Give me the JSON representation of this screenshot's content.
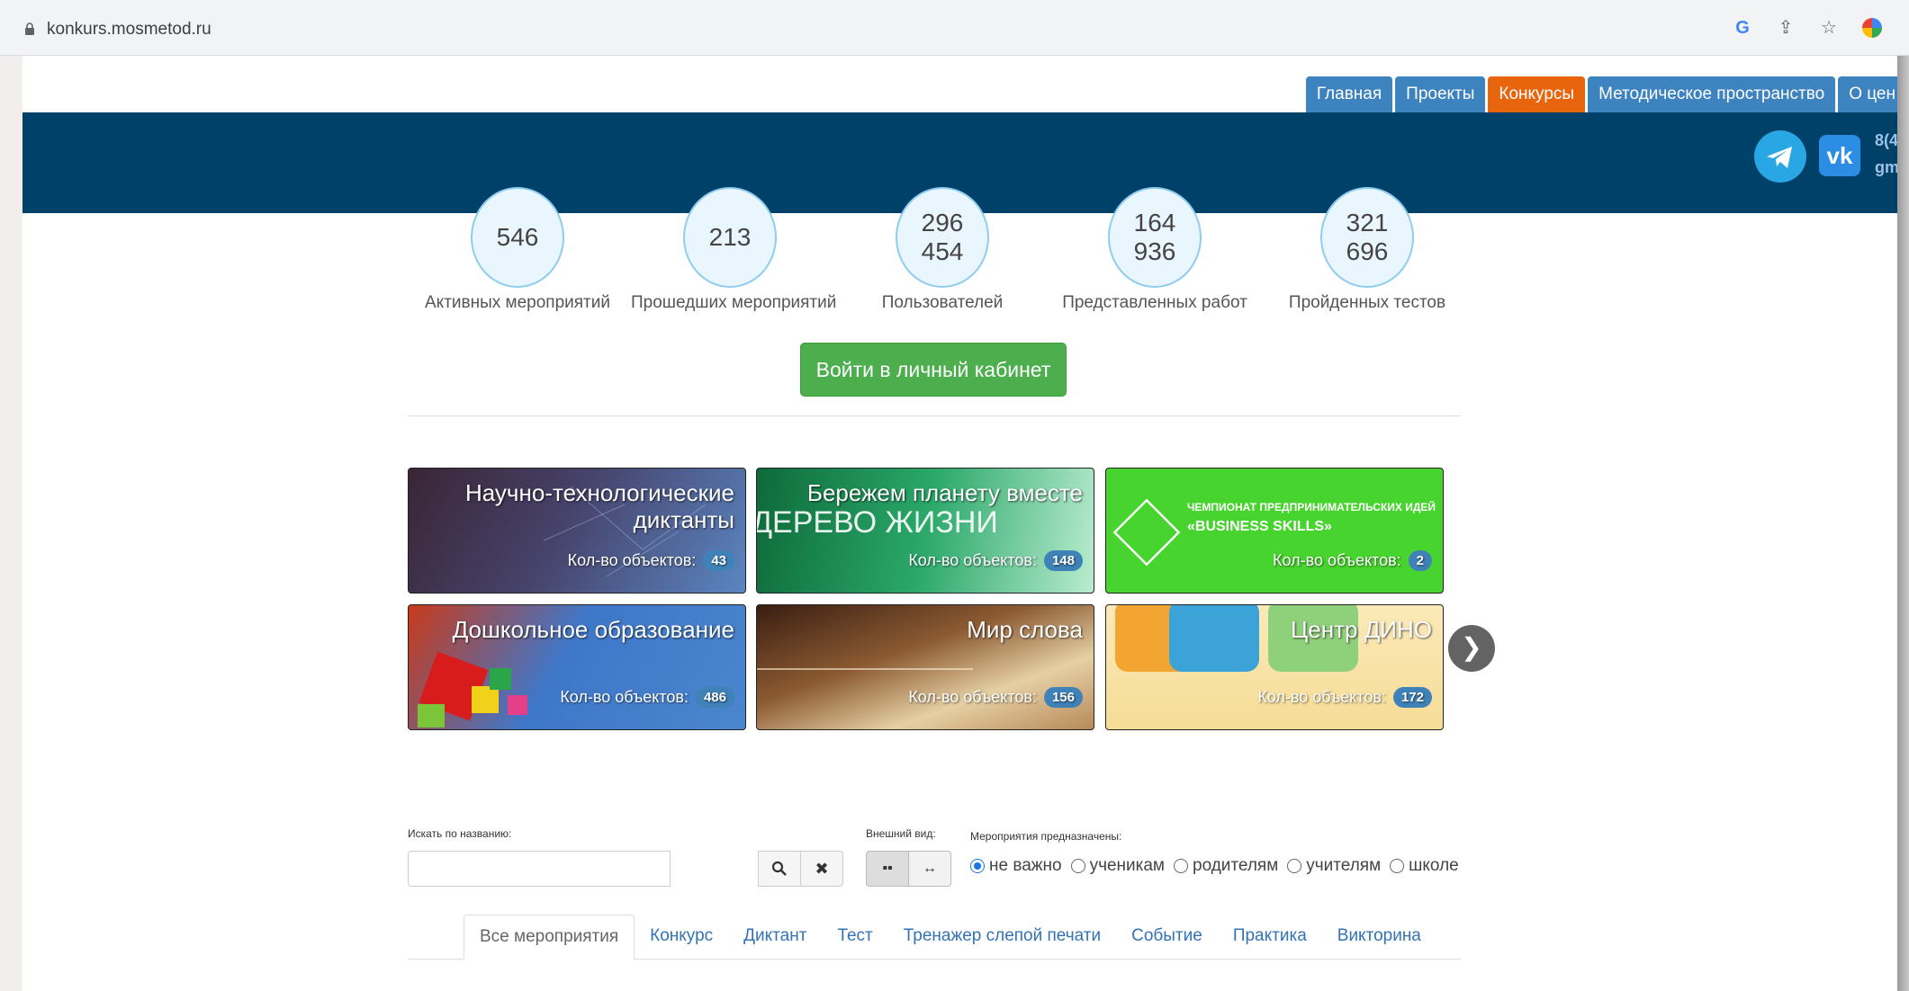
{
  "browser": {
    "url": "konkurs.mosmetod.ru"
  },
  "nav": {
    "tabs": [
      {
        "label": "Главная",
        "active": false
      },
      {
        "label": "Проекты",
        "active": false
      },
      {
        "label": "Конкурсы",
        "active": true
      },
      {
        "label": "Методическое пространство",
        "active": false
      },
      {
        "label": "О цен",
        "active": false
      }
    ]
  },
  "header": {
    "contact_line1": "8(4",
    "contact_line2": "gm"
  },
  "stats": [
    {
      "value": "546",
      "label": "Активных мероприятий"
    },
    {
      "value": "213",
      "label": "Прошедших мероприятий"
    },
    {
      "value": "296 454",
      "label": "Пользователей"
    },
    {
      "value": "164 936",
      "label": "Представленных работ"
    },
    {
      "value": "321 696",
      "label": "Пройденных тестов"
    }
  ],
  "login_button": "Войти в личный кабинет",
  "cards": [
    {
      "title": "Научно-технологические диктанты",
      "count_label": "Кол-во объектов:",
      "count": "43"
    },
    {
      "title": "Бережем планету вместе",
      "count_label": "Кол-во объектов:",
      "count": "148",
      "image_text": "ДЕРЕВО ЖИЗНИ"
    },
    {
      "title": "",
      "count_label": "Кол-во объектов:",
      "count": "2",
      "subtitle": "ЧЕМПИОНАТ ПРЕДПРИНИМАТЕЛЬСКИХ ИДЕЙ",
      "subtitle2": "«BUSINESS SKILLS»"
    },
    {
      "title": "Дошкольное образование",
      "count_label": "Кол-во объектов:",
      "count": "486"
    },
    {
      "title": "Мир слова",
      "count_label": "Кол-во объектов:",
      "count": "156"
    },
    {
      "title": "Центр ДИНО",
      "count_label": "Кол-во объектов:",
      "count": "172"
    }
  ],
  "filters": {
    "search_label": "Искать по названию:",
    "search_placeholder": "",
    "view_label": "Внешний вид:",
    "audience_label": "Мероприятия предназначены:",
    "audience_options": [
      {
        "label": "не важно",
        "checked": true
      },
      {
        "label": "ученикам",
        "checked": false
      },
      {
        "label": "родителям",
        "checked": false
      },
      {
        "label": "учителям",
        "checked": false
      },
      {
        "label": "школе",
        "checked": false
      }
    ]
  },
  "category_tabs": [
    {
      "label": "Все мероприятия",
      "active": true
    },
    {
      "label": "Конкурс",
      "active": false
    },
    {
      "label": "Диктант",
      "active": false
    },
    {
      "label": "Тест",
      "active": false
    },
    {
      "label": "Тренажер слепой печати",
      "active": false
    },
    {
      "label": "Событие",
      "active": false
    },
    {
      "label": "Практика",
      "active": false
    },
    {
      "label": "Викторина",
      "active": false
    }
  ],
  "colors": {
    "header_band": "#00416a",
    "nav_tab": "#3d83c0",
    "nav_tab_active": "#e8650e",
    "login_button": "#4cae4c",
    "badge": "#3e82b8"
  }
}
